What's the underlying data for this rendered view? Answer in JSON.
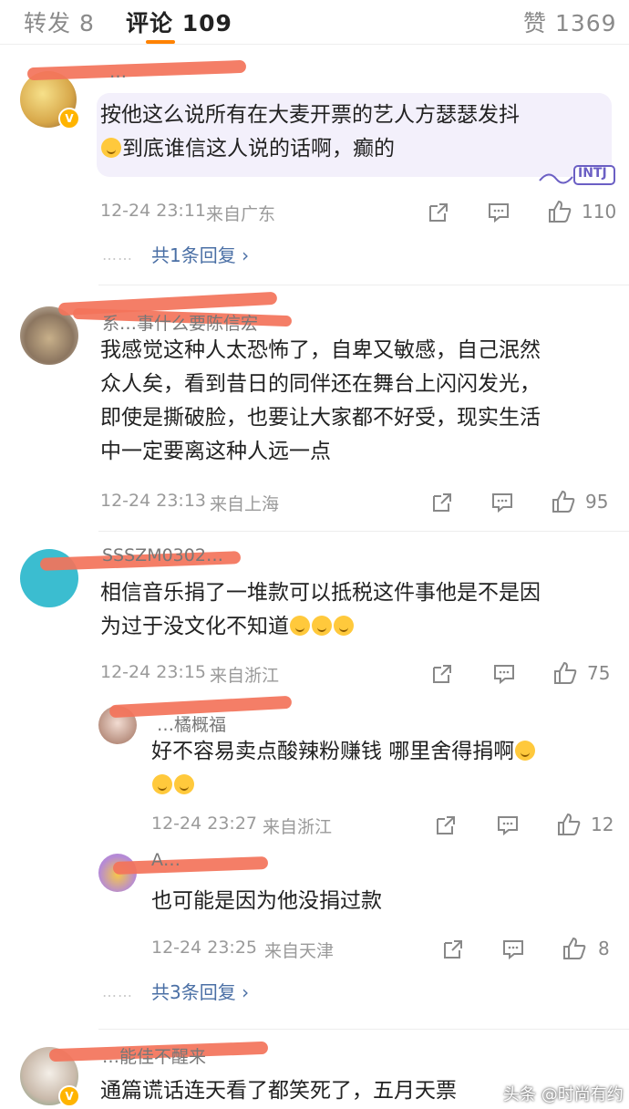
{
  "tabs": {
    "repost": "转发 8",
    "comments": "评论 109",
    "likes": "赞 1369"
  },
  "comments": [
    {
      "username": "…",
      "text": "按他这么说所有在大麦开票的艺人方瑟瑟发抖😭到底谁信这人说的话啊，癫的",
      "text_line1": "按他这么说所有在大麦开票的艺人方瑟瑟发抖",
      "text_line2": "到底谁信这人说的话啊，癫的",
      "time": "12-24 23:11",
      "location": "来自广东",
      "likes": "110",
      "replies_label": "共1条回复",
      "sticker_text": "INTJ"
    },
    {
      "username": "系…事什么要陈信宏",
      "text_lines": [
        "我感觉这种人太恐怖了，自卑又敏感，自己泯然",
        "众人矣，看到昔日的同伴还在舞台上闪闪发光，",
        "即使是撕破脸，也要让大家都不好受，现实生活",
        "中一定要离这种人远一点"
      ],
      "time": "12-24 23:13",
      "location": "来自上海",
      "likes": "95"
    },
    {
      "username": "SSSZM0302…",
      "text_lines": [
        "相信音乐捐了一堆款可以抵税这件事他是不是因",
        "为过于没文化不知道"
      ],
      "time": "12-24 23:15",
      "location": "来自浙江",
      "likes": "75",
      "replies": [
        {
          "username": "…橘概福",
          "text_lines": [
            "好不容易卖点酸辣粉赚钱 哪里舍得捐啊"
          ],
          "time": "12-24 23:27",
          "location": "来自浙江",
          "likes": "12"
        },
        {
          "username": "A…",
          "text_lines": [
            "也可能是因为他没捐过款"
          ],
          "time": "12-24 23:25",
          "location": "来自天津",
          "likes": "8"
        }
      ],
      "replies_label": "共3条回复"
    },
    {
      "username": "…能佳不醒来",
      "text_lines": [
        "通篇谎话连天看了都笑死了，五月天票"
      ],
      "time": "",
      "location": "",
      "likes": ""
    }
  ],
  "watermark": "头条 @时尚有约",
  "colors": {
    "accent": "#ff8200",
    "link": "#4a6fa5",
    "redaction": "#f3735a",
    "bubble": "#f3f0fb"
  },
  "icons": [
    "share-icon",
    "comment-icon",
    "like-icon",
    "chevron-right-icon",
    "verified-badge-icon",
    "emoji-icon"
  ]
}
